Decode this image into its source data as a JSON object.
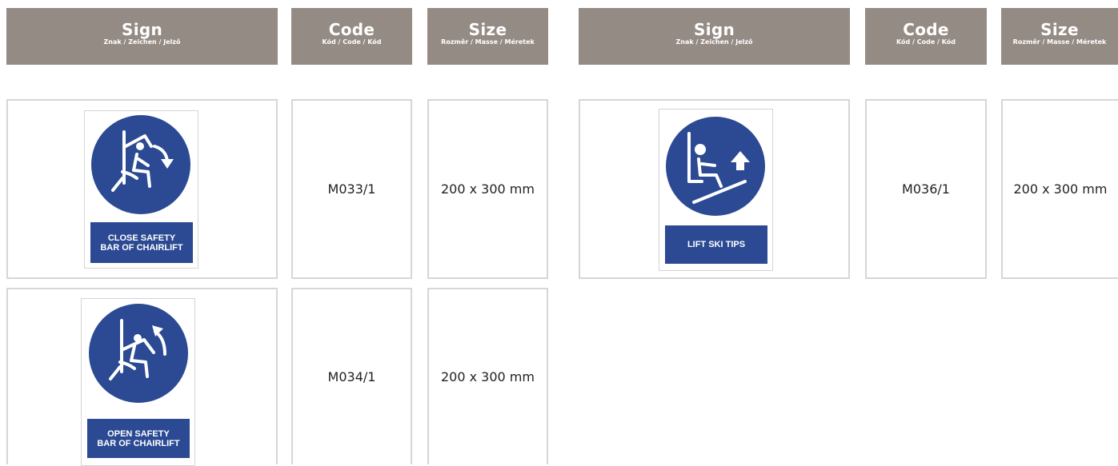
{
  "headers": {
    "sign": {
      "title": "Sign",
      "subtitle": "Znak / Zeichen / Jelző"
    },
    "code": {
      "title": "Code",
      "subtitle": "Kód / Code / Kód"
    },
    "size": {
      "title": "Size",
      "subtitle": "Rozměr / Masse / Méretek"
    }
  },
  "colors": {
    "header_bg": "#958b85",
    "sign_blue": "#2b4a93",
    "border": "#d6d6d6"
  },
  "products": [
    {
      "sign_caption_lines": [
        "CLOSE SAFETY",
        "BAR OF CHAIRLIFT"
      ],
      "icon": "close-safety-bar-icon",
      "code": "M033/1",
      "size": "200 x 300 mm"
    },
    {
      "sign_caption_lines": [
        "OPEN SAFETY",
        "BAR OF CHAIRLIFT"
      ],
      "icon": "open-safety-bar-icon",
      "code": "M034/1",
      "size": "200 x 300 mm"
    },
    {
      "sign_caption_lines": [
        "LIFT SKI TIPS"
      ],
      "icon": "lift-ski-tips-icon",
      "code": "M036/1",
      "size": "200 x 300 mm"
    }
  ]
}
